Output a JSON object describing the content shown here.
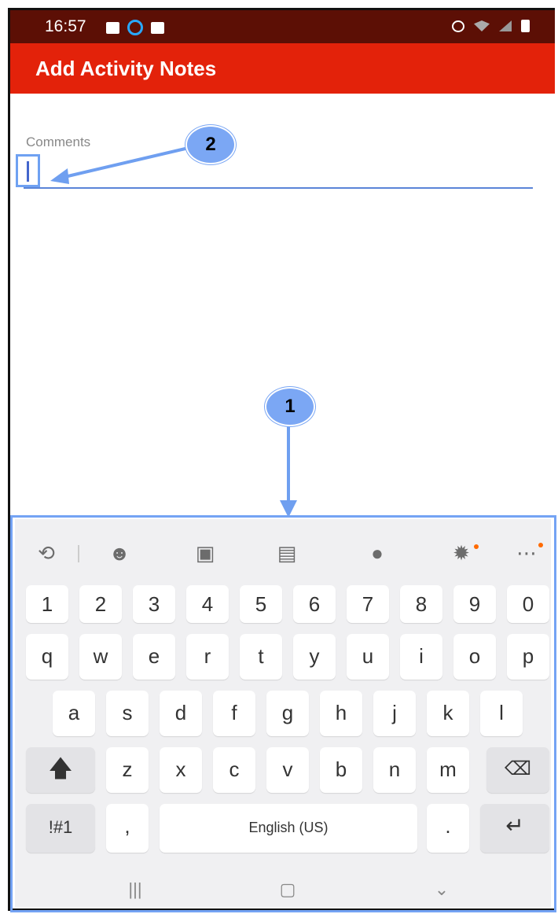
{
  "status_bar": {
    "time": "16:57"
  },
  "app_bar": {
    "title": "Add Activity Notes"
  },
  "form": {
    "comments_label": "Comments",
    "comments_value": ""
  },
  "callouts": [
    {
      "label": "2"
    },
    {
      "label": "1"
    }
  ],
  "keyboard": {
    "toolbar_icons": [
      "text-recognition-icon",
      "emoji-icon",
      "sticker-icon",
      "clipboard-icon",
      "microphone-icon",
      "settings-icon",
      "more-icon"
    ],
    "number_row": [
      "1",
      "2",
      "3",
      "4",
      "5",
      "6",
      "7",
      "8",
      "9",
      "0"
    ],
    "row1": [
      "q",
      "w",
      "e",
      "r",
      "t",
      "y",
      "u",
      "i",
      "o",
      "p"
    ],
    "row2": [
      "a",
      "s",
      "d",
      "f",
      "g",
      "h",
      "j",
      "k",
      "l"
    ],
    "row3": [
      "z",
      "x",
      "c",
      "v",
      "b",
      "n",
      "m"
    ],
    "symbols_label": "!#1",
    "comma_label": ",",
    "space_label": "English (US)",
    "period_label": ".",
    "nav_icons": [
      "recents-icon",
      "home-icon",
      "back-icon"
    ]
  },
  "colors": {
    "status_bar": "#5c0f05",
    "app_bar": "#e3220a",
    "accent": "#5a84d8",
    "callout": "#7ba7f4"
  }
}
